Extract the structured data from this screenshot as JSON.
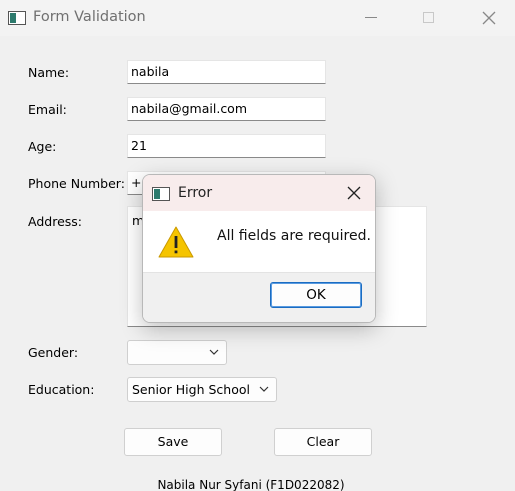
{
  "window": {
    "title": "Form Validation"
  },
  "form": {
    "name_label": "Name:",
    "name_value": "nabila",
    "email_label": "Email:",
    "email_value": "nabila@gmail.com",
    "age_label": "Age:",
    "age_value": "21",
    "phone_label": "Phone Number:",
    "phone_value": "+6",
    "address_label": "Address:",
    "address_value": "m",
    "gender_label": "Gender:",
    "gender_value": "",
    "education_label": "Education:",
    "education_value": "Senior High School",
    "save_label": "Save",
    "clear_label": "Clear"
  },
  "footer": {
    "text": "Nabila Nur Syfani (F1D022082)"
  },
  "dialog": {
    "title": "Error",
    "message": "All fields are required.",
    "ok_label": "OK",
    "icon": "warning-icon"
  },
  "colors": {
    "accent": "#1a6cc2",
    "warning": "#f5c400",
    "dialog_title_bg": "#f8ecec"
  }
}
